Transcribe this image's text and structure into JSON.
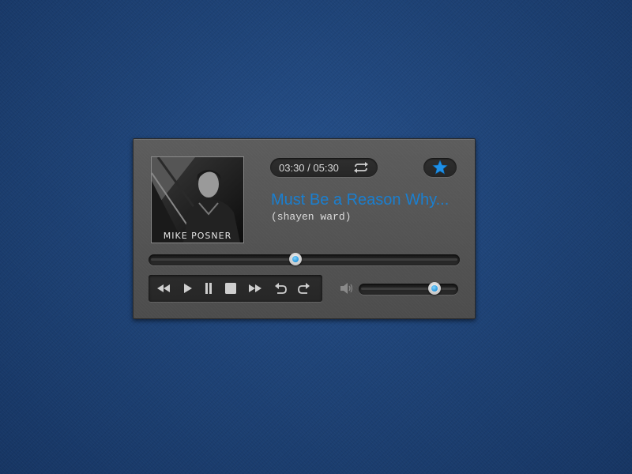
{
  "player": {
    "album": {
      "art_text": "MIKE POSNER"
    },
    "time": {
      "display": "03:30 / 05:30",
      "current": "03:30",
      "total": "05:30"
    },
    "song_title": "Must Be a Reason Why...",
    "artist": "(shayen ward)",
    "progress_fraction": 0.47,
    "volume_fraction": 0.8,
    "icons": {
      "repeat": "repeat-icon",
      "favorite": "star-icon",
      "rewind": "rewind-icon",
      "play": "play-icon",
      "pause": "pause-icon",
      "stop": "stop-icon",
      "fast_forward": "fast-forward-icon",
      "undo": "undo-icon",
      "redo": "redo-icon",
      "volume": "speaker-icon"
    },
    "colors": {
      "accent": "#1a7fd0",
      "star": "#1e90e8",
      "background": "#1e4377",
      "panel": "#555555"
    }
  }
}
